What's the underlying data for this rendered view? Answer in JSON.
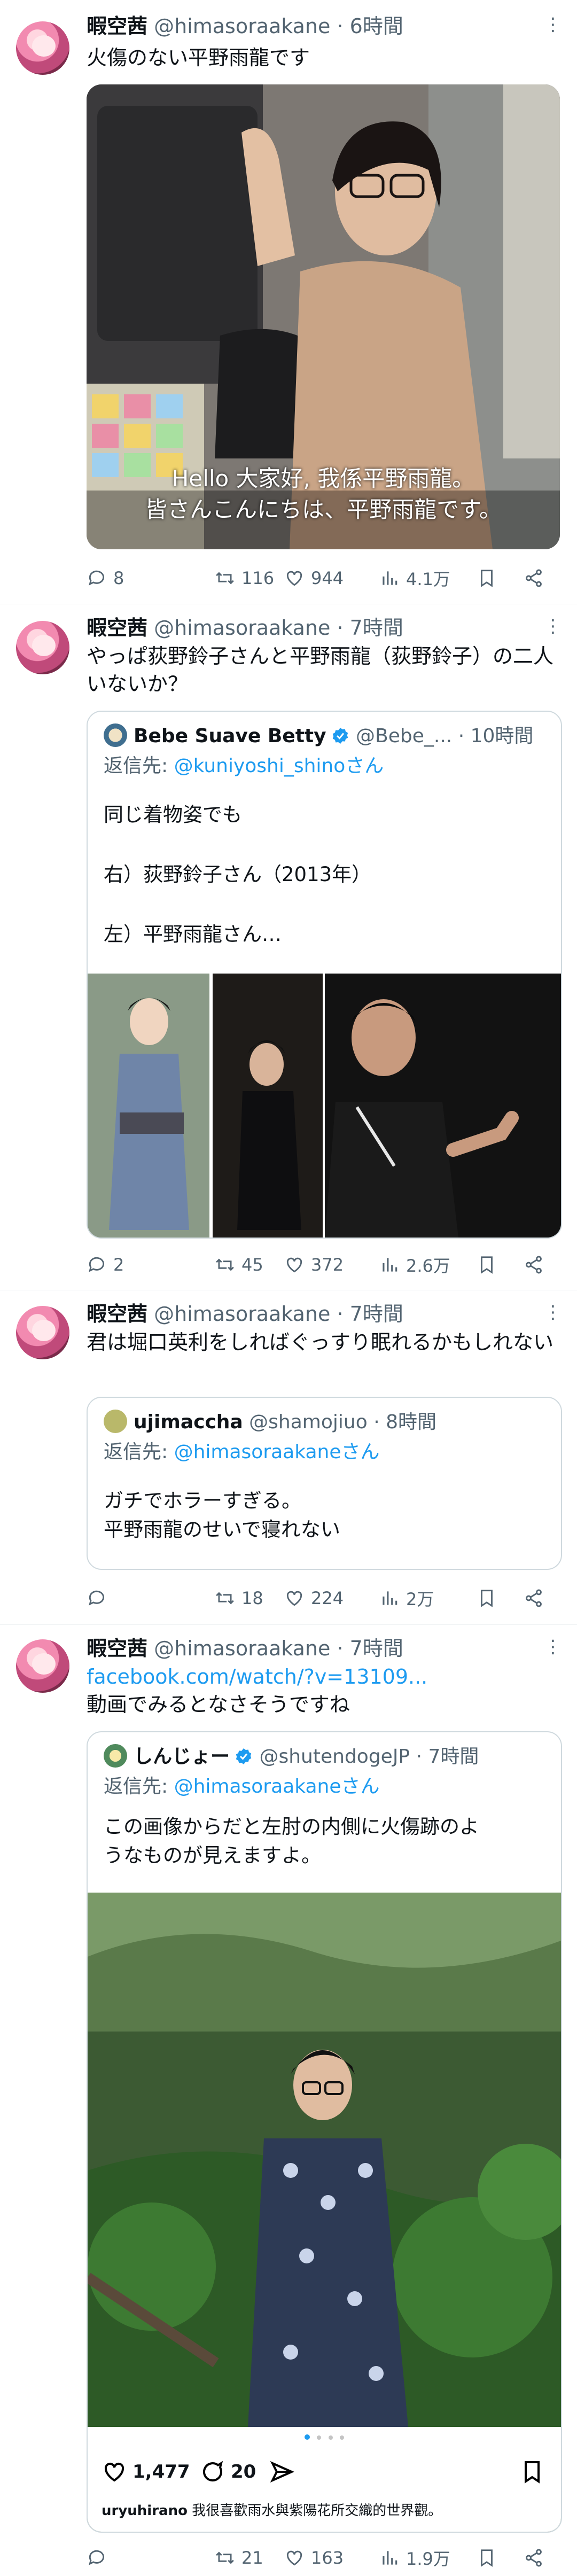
{
  "colors": {
    "accent": "#1d9bf0",
    "muted": "#536471",
    "text": "#0f1419",
    "border": "#cfd9de"
  },
  "tweets": [
    {
      "name": "暇空茜",
      "handle": "@himasoraakane",
      "time": "· 6時間",
      "text": "火傷のない平野雨龍です",
      "video_subtitle_1": "Hello 大家好, 我係平野雨龍。",
      "video_subtitle_2": "皆さんこんにちは、平野雨龍です。",
      "stats": {
        "replies": "8",
        "retweets": "116",
        "likes": "944",
        "views": "4.1万"
      }
    },
    {
      "name": "暇空茜",
      "handle": "@himasoraakane",
      "time": "· 7時間",
      "text": "やっぱ荻野鈴子さんと平野雨龍（荻野鈴子）の二人いないか？",
      "quote": {
        "name": "Bebe Suave Betty",
        "handle": "@Bebe_...",
        "time": "· 10時間",
        "reply_prefix": "返信先: ",
        "reply_mention": "@kuniyoshi_shinoさん",
        "line1": "同じ着物姿でも",
        "line2": "右）荻野鈴子さん（2013年）",
        "line3": "左）平野雨龍さん…"
      },
      "stats": {
        "replies": "2",
        "retweets": "45",
        "likes": "372",
        "views": "2.6万"
      }
    },
    {
      "name": "暇空茜",
      "handle": "@himasoraakane",
      "time": "· 7時間",
      "text": "君は堀口英利をしればぐっすり眠れるかもしれない",
      "quote": {
        "name": "ujimaccha",
        "handle": "@shamojiuo",
        "time": "· 8時間",
        "reply_prefix": "返信先: ",
        "reply_mention": "@himasoraakaneさん",
        "line1": "ガチでホラーすぎる。",
        "line2": "平野雨龍のせいで寝れない"
      },
      "stats": {
        "replies": "",
        "retweets": "18",
        "likes": "224",
        "views": "2万"
      }
    },
    {
      "name": "暇空茜",
      "handle": "@himasoraakane",
      "time": "· 7時間",
      "link": "facebook.com/watch/?v=13109...",
      "text": "動画でみるとなさそうですね",
      "quote": {
        "name": "しんじょー",
        "handle": "@shutendogeJP",
        "time": "· 7時間",
        "reply_prefix": "返信先: ",
        "reply_mention": "@himasoraakaneさん",
        "line1": "この画像からだと左肘の内側に火傷跡のよ",
        "line2": "うなものが見えますよ。",
        "ig_likes": "1,477",
        "ig_comments": "20",
        "ig_caption_user": "uryuhirano",
        "ig_caption_text": "我很喜歡雨水與紫陽花所交織的世界觀。"
      },
      "stats": {
        "replies": "",
        "retweets": "21",
        "likes": "163",
        "views": "1.9万"
      }
    }
  ],
  "icons": [
    "reply-icon",
    "retweet-icon",
    "like-icon",
    "views-icon",
    "bookmark-icon",
    "share-icon",
    "more-icon",
    "verified-icon"
  ]
}
